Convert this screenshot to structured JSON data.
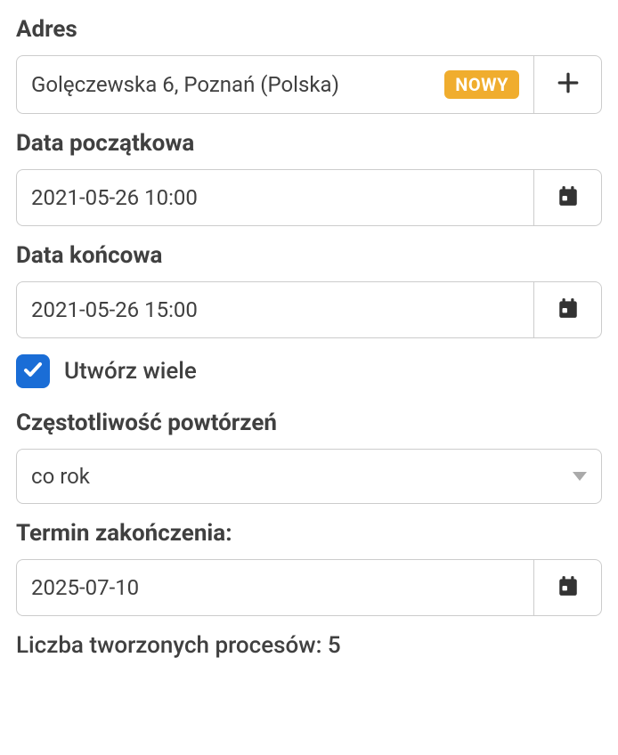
{
  "address": {
    "label": "Adres",
    "value": "Golęczewska 6, Poznań (Polska)",
    "badge": "NOWY"
  },
  "startDate": {
    "label": "Data początkowa",
    "value": "2021-05-26 10:00"
  },
  "endDate": {
    "label": "Data końcowa",
    "value": "2021-05-26 15:00"
  },
  "createMany": {
    "label": "Utwórz wiele",
    "checked": true
  },
  "frequency": {
    "label": "Częstotliwość powtórzeń",
    "value": "co rok"
  },
  "termination": {
    "label": "Termin zakończenia:",
    "value": "2025-07-10"
  },
  "summary": {
    "text": "Liczba tworzonych procesów: 5"
  }
}
